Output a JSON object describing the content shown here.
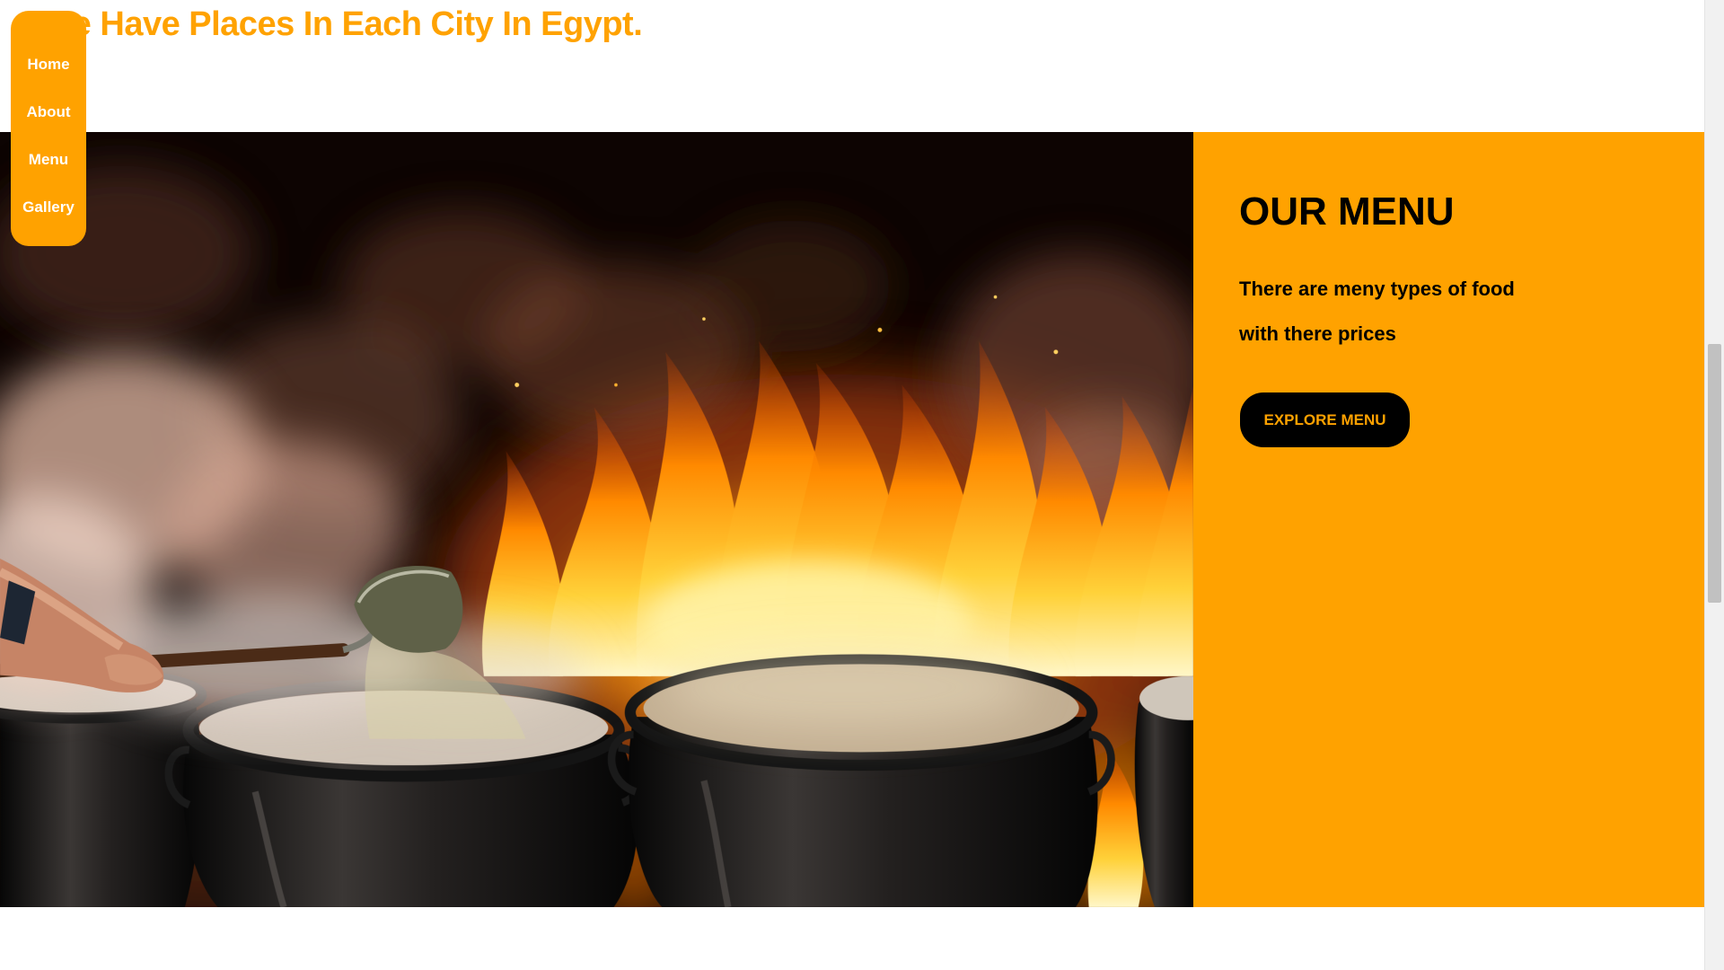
{
  "heading": "We Have Places In Each City In Egypt.",
  "nav": {
    "items": [
      {
        "label": "Home"
      },
      {
        "label": "About"
      },
      {
        "label": "Menu"
      },
      {
        "label": "Gallery"
      }
    ]
  },
  "menu_section": {
    "title": "OUR MENU",
    "description_line1": "There are meny types of food",
    "description_line2": "with there prices",
    "button_label": "EXPLORE MENU"
  },
  "colors": {
    "accent": "#ffa200",
    "dark": "#000000",
    "nav_text": "#ffffff"
  }
}
